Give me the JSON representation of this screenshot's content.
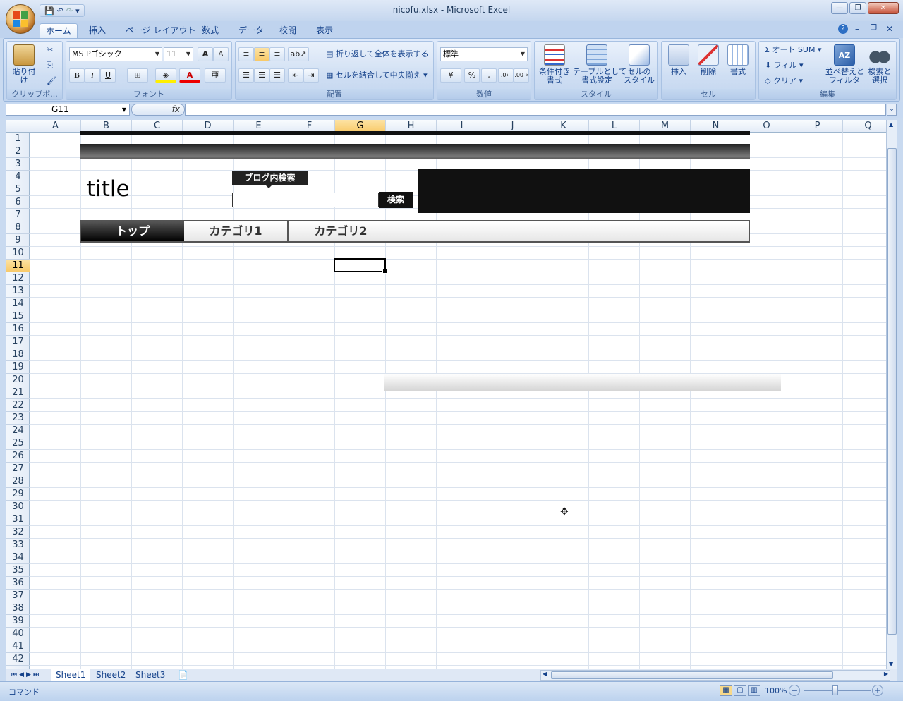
{
  "window": {
    "title": "nicofu.xlsx - Microsoft Excel"
  },
  "qat": {
    "items": [
      "save-icon",
      "undo-icon",
      "redo-icon",
      "customize-icon"
    ]
  },
  "tabs": [
    "ホーム",
    "挿入",
    "ページ レイアウト",
    "数式",
    "データ",
    "校閲",
    "表示"
  ],
  "ribbon": {
    "clipboard": {
      "paste": "貼り付け",
      "label": "クリップボ..."
    },
    "font": {
      "name": "MS Pゴシック",
      "size": "11",
      "label": "フォント",
      "bold": "B",
      "italic": "I",
      "underline": "U",
      "grow": "A",
      "shrink": "A",
      "fontcolor": "A"
    },
    "alignment": {
      "wrap": "折り返して全体を表示する",
      "merge": "セルを結合して中央揃え",
      "label": "配置"
    },
    "number": {
      "format": "標準",
      "percent": "%",
      "comma": ",",
      "label": "数値"
    },
    "styles": {
      "conditional": "条件付き\n書式",
      "table": "テーブルとして\n書式設定",
      "cellstyle": "セルの\nスタイル",
      "label": "スタイル"
    },
    "cells": {
      "insert": "挿入",
      "delete": "削除",
      "format": "書式",
      "label": "セル"
    },
    "editing": {
      "autosum": "Σ オート SUM",
      "fill": "フィル",
      "clear": "クリア",
      "sort": "並べ替えと\nフィルタ",
      "find": "検索と\n選択",
      "label": "編集"
    }
  },
  "formula_bar": {
    "name_box": "G11",
    "fx": "fx",
    "value": ""
  },
  "columns": [
    "A",
    "B",
    "C",
    "D",
    "E",
    "F",
    "G",
    "H",
    "I",
    "J",
    "K",
    "L",
    "M",
    "N",
    "O",
    "P",
    "Q"
  ],
  "selected_column": "G",
  "rows": [
    "1",
    "2",
    "3",
    "4",
    "5",
    "6",
    "7",
    "8",
    "9",
    "10",
    "11",
    "12",
    "13",
    "14",
    "15",
    "16",
    "17",
    "18",
    "19",
    "20",
    "21",
    "22",
    "23",
    "24",
    "25",
    "26",
    "27",
    "28",
    "29",
    "30",
    "31",
    "32",
    "33",
    "34",
    "35",
    "36",
    "37",
    "38",
    "39",
    "40",
    "41",
    "42"
  ],
  "selected_row": "11",
  "design": {
    "title": "title",
    "search_label": "ブログ内検索",
    "search_button": "検索",
    "nav": [
      "トップ",
      "カテゴリ1",
      "カテゴリ2"
    ]
  },
  "sheets": [
    "Sheet1",
    "Sheet2",
    "Sheet3"
  ],
  "active_sheet": "Sheet1",
  "status": {
    "mode": "コマンド",
    "zoom": "100%"
  }
}
